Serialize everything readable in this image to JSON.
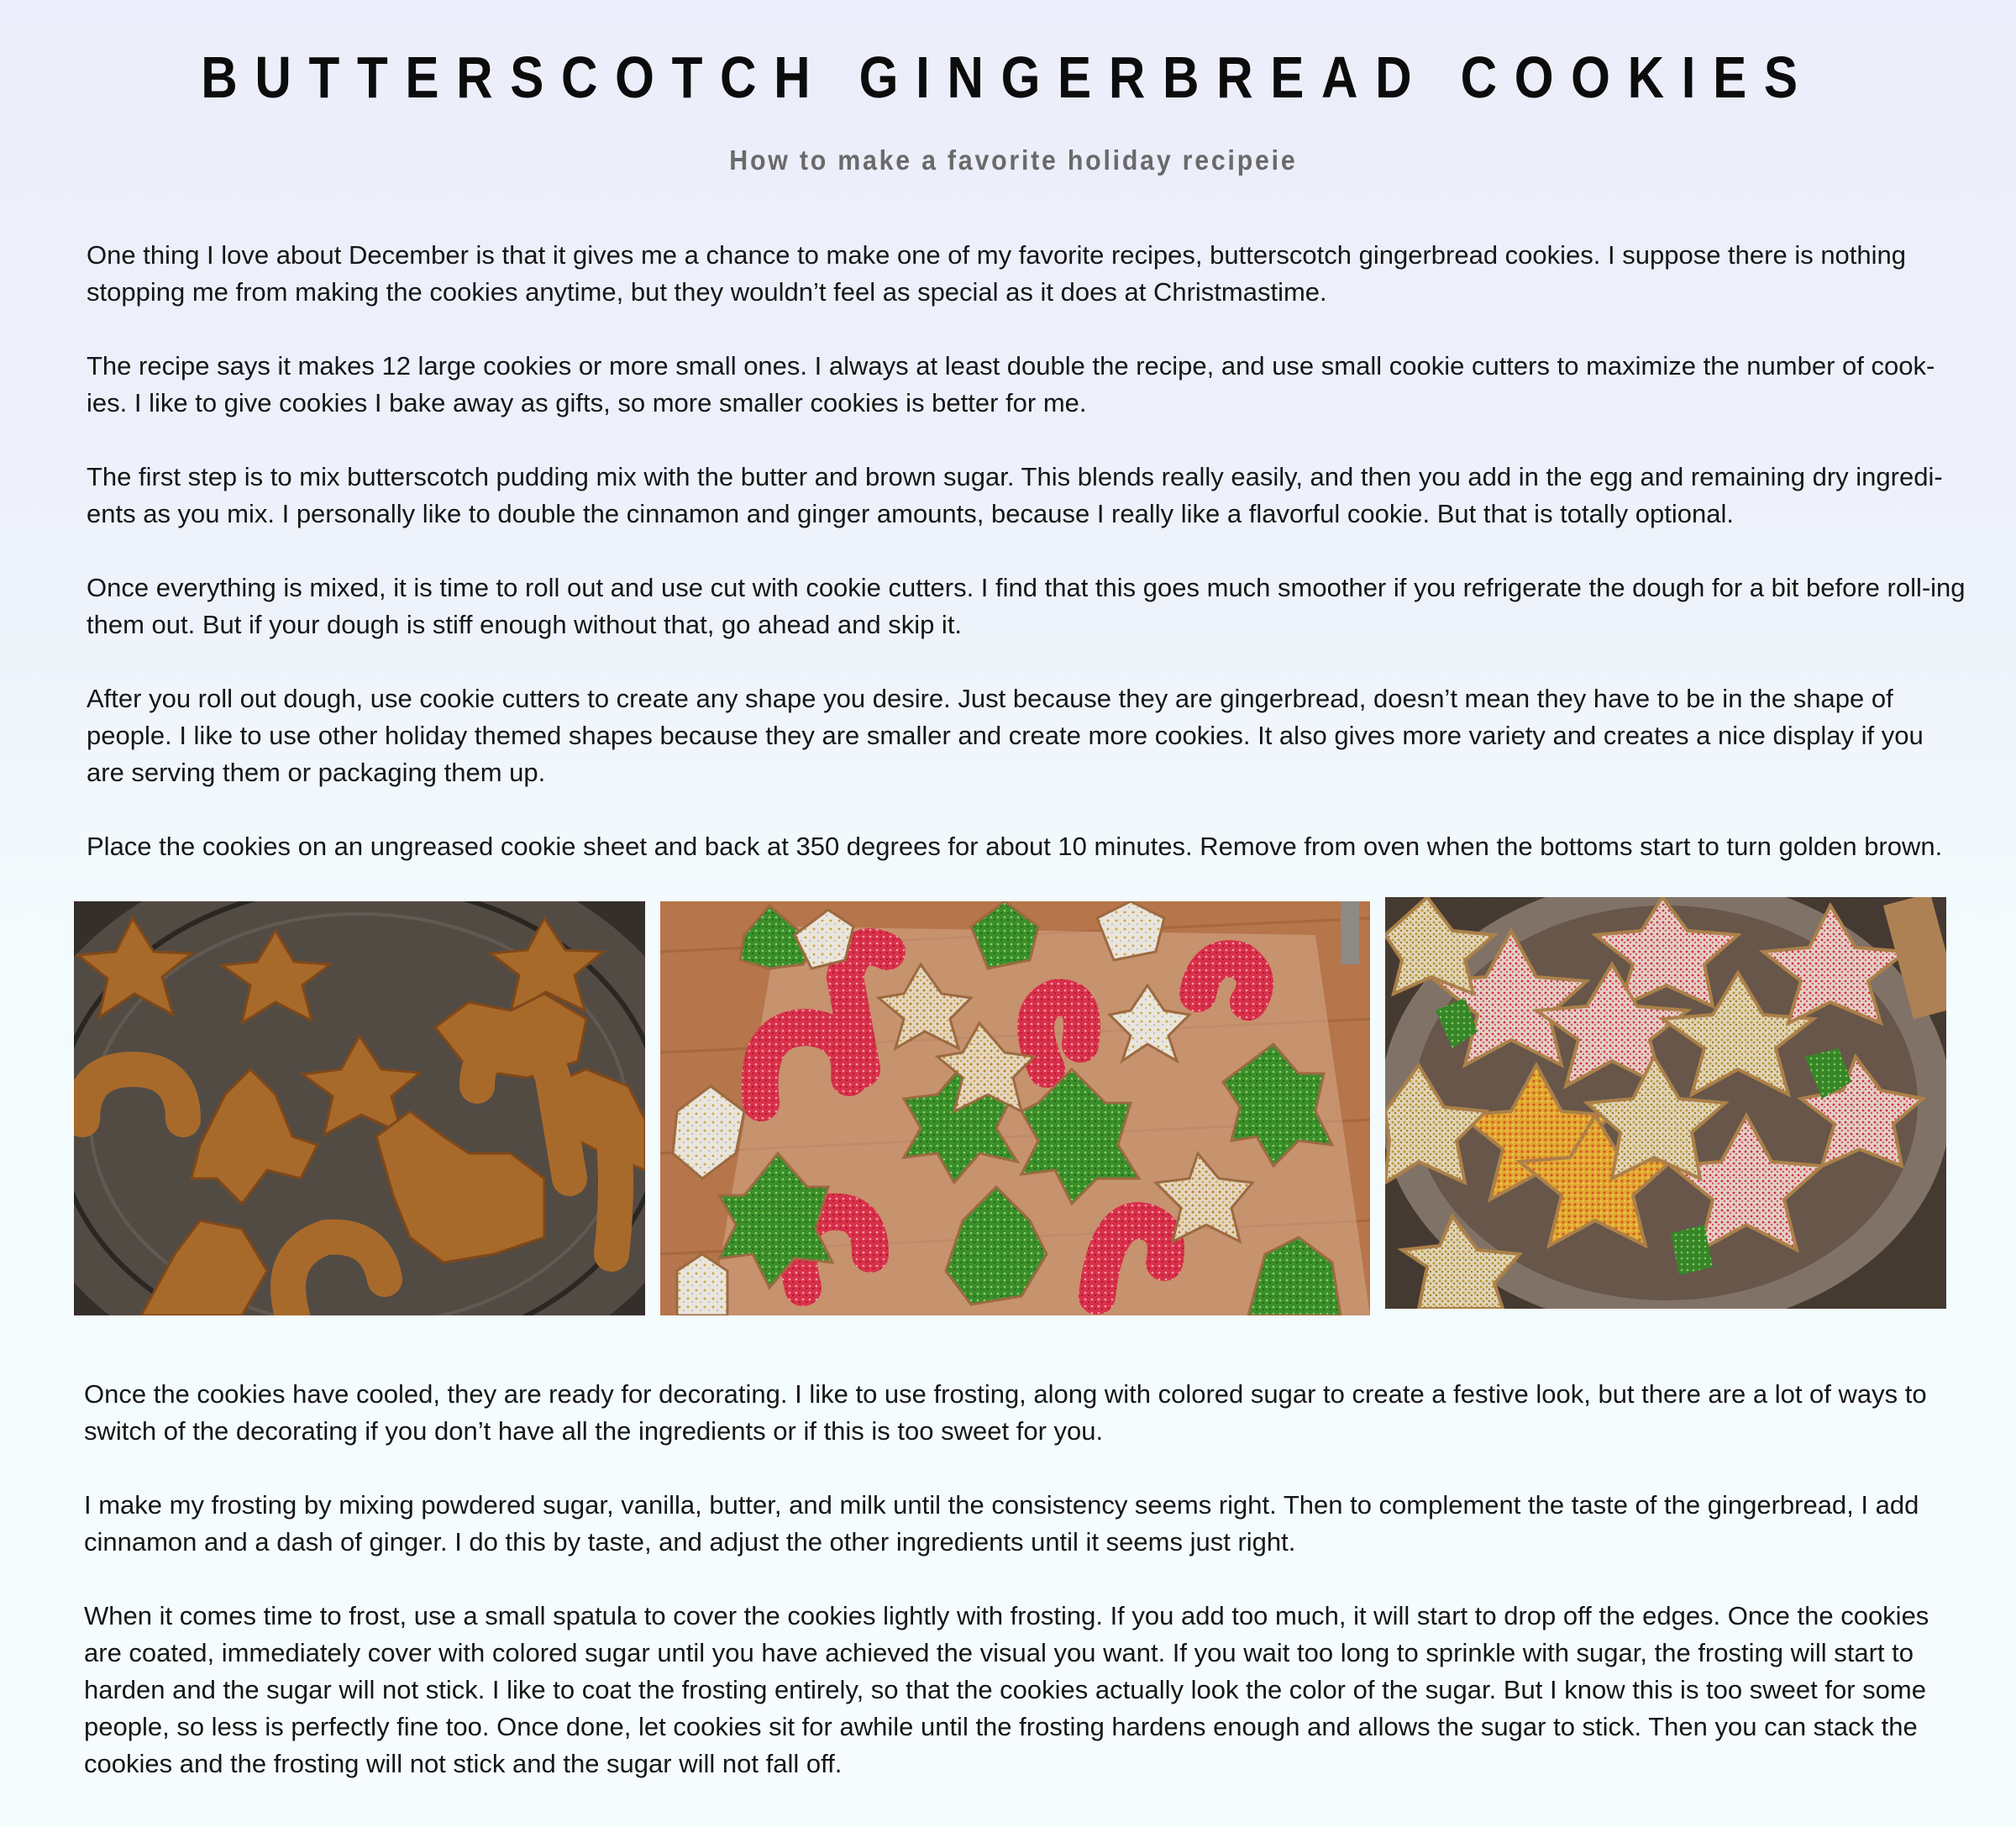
{
  "article": {
    "title": "BUTTERSCOTCH GINGERBREAD COOKIES",
    "subtitle": "How to make a favorite holiday recipeie",
    "paragraphs_top": [
      "One thing I love about December is that it gives me a chance to make one of my favorite recipes, butterscotch gingerbread cookies. I suppose there is nothing stopping me from making the cookies anytime, but they wouldn’t feel as special as it does at Christmastime.",
      "The recipe says it makes 12 large cookies or more small ones. I always at least double the recipe, and use small cookie cutters to maximize the number of cook-ies. I like to give cookies I bake away as gifts, so more smaller cookies is better for me.",
      "The first step is to mix butterscotch pudding mix with the butter and brown sugar. This blends really easily, and then you add in the egg and remaining dry ingredi-ents as you mix. I personally like to double the cinnamon and ginger amounts, because I really like a flavorful cookie. But that is totally optional.",
      "Once everything is mixed, it is time to roll out and use cut with cookie cutters. I find that this goes much smoother if you refrigerate the dough for a bit before roll-ing them out. But if your dough is stiff enough without that, go ahead and skip it.",
      "After you roll out dough, use cookie cutters to create any shape you desire. Just because they are gingerbread, doesn’t mean they have to be in the shape of people. I like to use other holiday themed shapes because they are smaller and create more cookies. It also gives more variety and creates a nice display if you are serving them or packaging them up.",
      "Place the cookies on an ungreased cookie sheet and back at 350 degrees for about 10 minutes. Remove from oven when the bottoms start to turn golden brown."
    ],
    "paragraphs_bottom": [
      "Once the cookies have cooled, they are ready for decorating. I like to use frosting, along with colored sugar to create a festive look, but there are a lot of ways to switch of the decorating if you don’t have all the ingredients or if this is too sweet for you.",
      "I make my frosting by mixing powdered sugar, vanilla, butter, and milk until the consistency seems right. Then to complement the taste of the gingerbread, I add cinnamon and a dash of ginger. I do this by taste, and adjust the other ingredients until it seems just right.",
      "When it comes time to frost, use a small spatula to cover the cookies lightly with frosting. If you add too much, it will start to drop off the edges. Once the cookies are coated, immediately cover with colored sugar until you have achieved the visual you want. If you wait too long to sprinkle with sugar, the frosting will start to harden and the sugar will not stick. I like to coat the frosting entirely, so that the cookies actually look the color of the sugar. But I know this is too sweet for some people, so less is perfectly fine too. Once done, let cookies sit for awhile until the frosting hardens enough and allows the sugar to stick. Then you can stack the cookies and the frosting will not stick and the sugar will not fall off."
    ]
  },
  "colors": {
    "background": "#eef2fb",
    "text": "#161616",
    "subtitle": "#6a6a6a",
    "gingerbread": "#b7732f",
    "frosting_red": "#d9304a",
    "frosting_green": "#3a8f2a",
    "frosting_white": "#e9e4dc",
    "sugar_gold": "#c9a33a"
  }
}
